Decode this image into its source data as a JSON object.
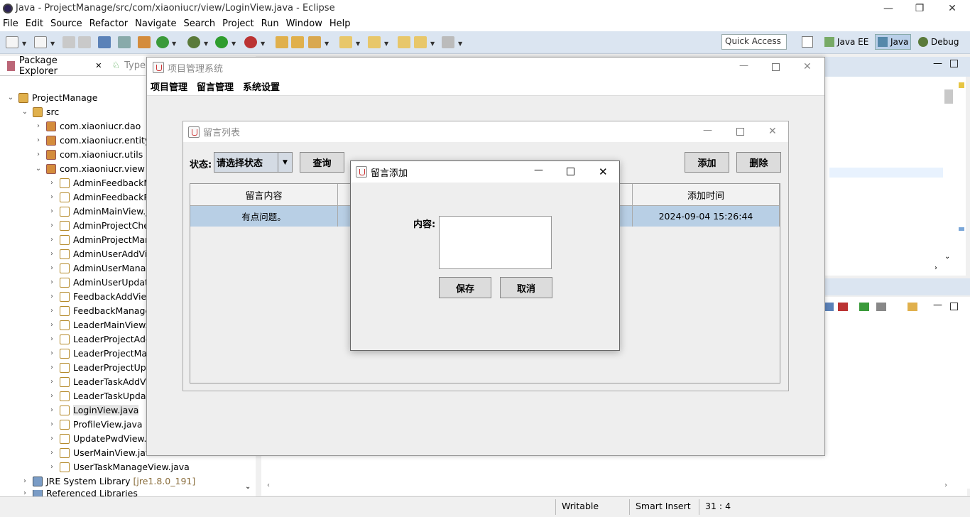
{
  "eclipse": {
    "title": "Java - ProjectManage/src/com/xiaoniucr/view/LoginView.java - Eclipse",
    "menu": [
      "File",
      "Edit",
      "Source",
      "Refactor",
      "Navigate",
      "Search",
      "Project",
      "Run",
      "Window",
      "Help"
    ],
    "quick_access": "Quick Access",
    "perspectives": [
      "Java EE",
      "Java",
      "Debug"
    ],
    "status": {
      "writable": "Writable",
      "insert": "Smart Insert",
      "position": "31 : 4"
    }
  },
  "package_explorer": {
    "tab_label": "Package Explorer",
    "tab2_label": "Type",
    "project": "ProjectManage",
    "src": "src",
    "packages": [
      "com.xiaoniucr.dao",
      "com.xiaoniucr.entity",
      "com.xiaoniucr.utils",
      "com.xiaoniucr.view"
    ],
    "files": [
      "AdminFeedbackM",
      "AdminFeedbackR",
      "AdminMainView.j",
      "AdminProjectChe",
      "AdminProjectMar",
      "AdminUserAddVi",
      "AdminUserManag",
      "AdminUserUpdat",
      "FeedbackAddView",
      "FeedbackManage",
      "LeaderMainView.",
      "LeaderProjectAdc",
      "LeaderProjectMa",
      "LeaderProjectUpc",
      "LeaderTaskAddV",
      "LeaderTaskUpda",
      "LoginView.java",
      "ProfileView.java",
      "UpdatePwdView.j",
      "UserMainView.java",
      "UserTaskManageView.java"
    ],
    "jre": "JRE System Library",
    "jre_version": "[jre1.8.0_191]",
    "referenced": "Referenced Libraries"
  },
  "app_window": {
    "title": "项目管理系统",
    "menu": [
      "项目管理",
      "留言管理",
      "系统设置"
    ]
  },
  "message_list": {
    "title": "留言列表",
    "status_label": "状态:",
    "status_value": "请选择状态",
    "query": "查询",
    "add": "添加",
    "delete": "删除",
    "columns": [
      "留言内容",
      "添加时间"
    ],
    "rows": [
      {
        "content": "有点问题。",
        "time": "2024-09-04 15:26:44"
      }
    ]
  },
  "add_dialog": {
    "title": "留言添加",
    "content_label": "内容:",
    "content_value": "",
    "save": "保存",
    "cancel": "取消"
  }
}
